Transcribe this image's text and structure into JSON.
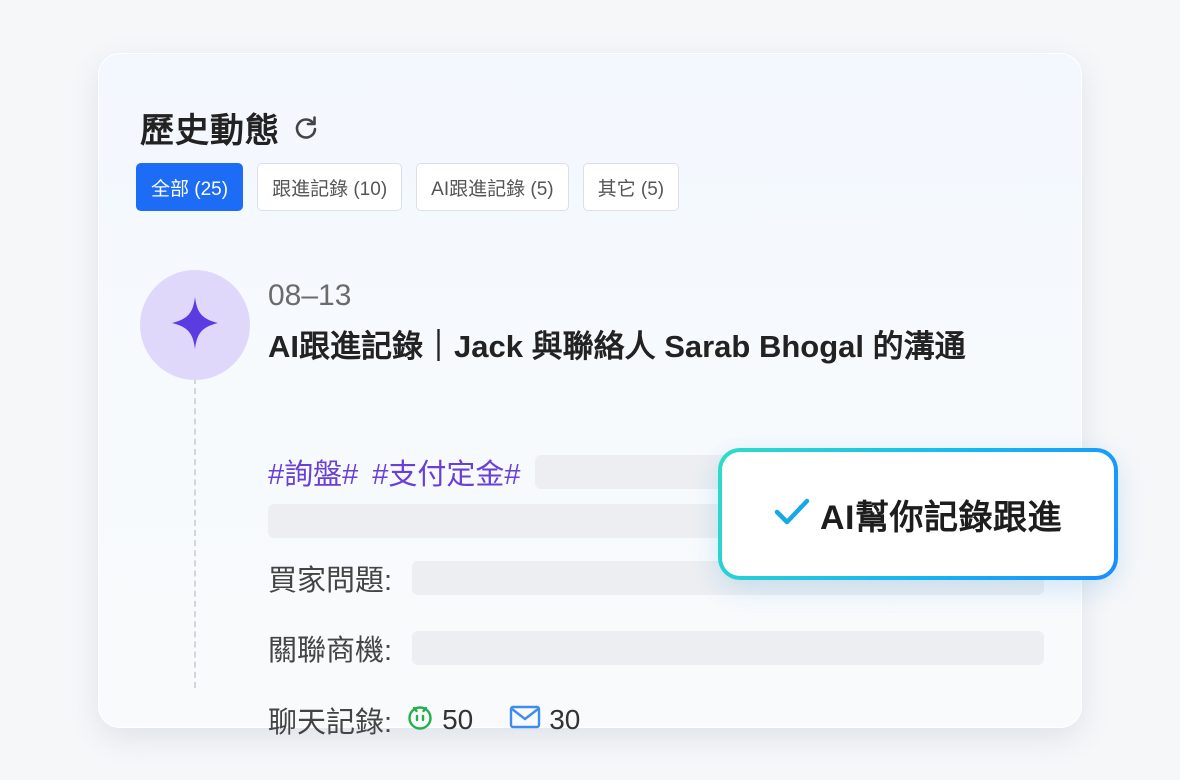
{
  "panel": {
    "title": "歷史動態",
    "refresh_icon": "refresh-icon"
  },
  "tabs": [
    {
      "label": "全部 (25)",
      "active": true
    },
    {
      "label": "跟進記錄 (10)",
      "active": false
    },
    {
      "label": "AI跟進記錄 (5)",
      "active": false
    },
    {
      "label": "其它 (5)",
      "active": false
    }
  ],
  "entry": {
    "icon": "sparkle-icon",
    "date": "08–13",
    "title": "AI跟進記錄｜Jack 與聯絡人 Sarab Bhogal 的溝通",
    "tags": [
      "#詢盤#",
      "#支付定金#"
    ],
    "fields": {
      "buyer_question_label": "買家問題:",
      "related_opportunity_label": "關聯商機:",
      "chat_records_label": "聊天記錄:"
    },
    "chat": {
      "chat_icon": "chat-bubble-icon",
      "chat_count": "50",
      "mail_icon": "mail-icon",
      "mail_count": "30"
    }
  },
  "callout": {
    "check_icon": "check-icon",
    "text": "AI幫你記錄跟進"
  },
  "colors": {
    "accent": "#1c6cf5",
    "tag": "#6a3fd6",
    "avatar_bg": "#e0d8fb",
    "sparkle": "#5b3ce0",
    "callout_border_start": "#2fdcc8",
    "callout_border_end": "#1a8cff"
  }
}
